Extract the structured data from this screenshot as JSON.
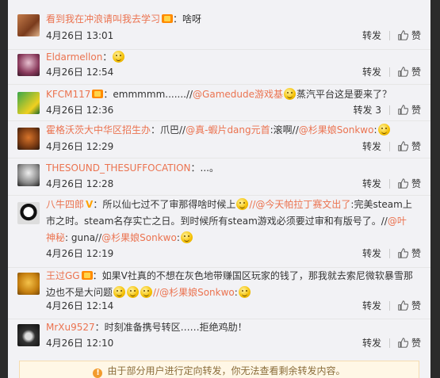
{
  "actions": {
    "forward": "转发",
    "like": "赞"
  },
  "comments": [
    {
      "user": "看到我在冲浪请叫我去学习",
      "text": "：啥呀",
      "time": "4月26日 13:01",
      "forward": "转发"
    },
    {
      "user": "Eldarmellon",
      "text": "：",
      "time": "4月26日 12:54",
      "forward": "转发"
    },
    {
      "user": "KFCM117",
      "text_pre": "：emmmmm.......//",
      "mention": "@Gamedude游戏基",
      "text_post": "蒸汽平台这是要来了？",
      "time": "4月26日 12:36",
      "forward": "转发 3"
    },
    {
      "user": "霍格沃茨大中华区招生办",
      "text_pre": "：爪巴//",
      "mention": "@真-蝦片dang元首",
      "text_mid": ":滚啊//",
      "mention2": "@杉果娘Sonkwo",
      "text_post": ":",
      "time": "4月26日 12:29",
      "forward": "转发"
    },
    {
      "user": "THESOUND_THESUFFOCATION",
      "text": "：...。",
      "time": "4月26日 12:28",
      "forward": "转发"
    },
    {
      "user": "八牛四郎",
      "text_pre": "：所以仙七过不了审那得啥时候上",
      "mention": "//@今天帕拉丁赛文出了",
      "text_mid": ":完美steam上市之时。steam名存实亡之日。到时候所有steam游戏必须要过审和有版号了。//",
      "mention2": "@叶神秘",
      "text_mid2": ": guna//",
      "mention3": "@杉果娘Sonkwo",
      "text_post": ":",
      "time": "4月26日 12:19",
      "forward": "转发"
    },
    {
      "user": "王过GG",
      "text_pre": "：如果V社真的不想在灰色地带赚国区玩家的钱了，那我就去索尼微软暴雪那边也不是大问题",
      "mention": "//@杉果娘Sonkwo",
      "text_post": ":",
      "time": "4月26日 12:14",
      "forward": "转发"
    },
    {
      "user": "MrXu9527",
      "text": "：时刻准备携号转区……拒绝鸡肋！",
      "time": "4月26日 12:10",
      "forward": "转发"
    }
  ],
  "notice": "由于部分用户进行定向转发，你无法查看剩余转发内容。",
  "colors": {
    "accent": "#eb7350",
    "background": "#f2f2f5",
    "outer": "#2b2b2b"
  }
}
